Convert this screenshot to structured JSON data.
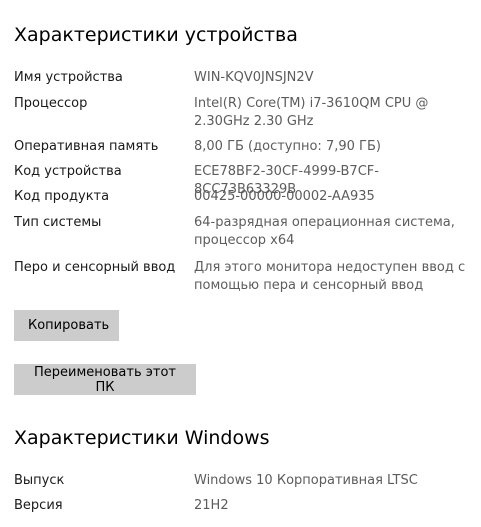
{
  "device_specs": {
    "title": "Характеристики устройства",
    "rows": [
      {
        "label": "Имя устройства",
        "value": "WIN-KQV0JNSJN2V"
      },
      {
        "label": "Процессор",
        "value": "Intel(R) Core(TM) i7-3610QM CPU @\n2.30GHz   2.30 GHz"
      },
      {
        "label": "Оперативная память",
        "value": "8,00 ГБ (доступно: 7,90 ГБ)"
      },
      {
        "label": "Код устройства",
        "value": "ECE78BF2-30CF-4999-B7CF-8CC73B63329B"
      },
      {
        "label": "Код продукта",
        "value": "00425-00000-00002-AA935"
      },
      {
        "label": "Тип системы",
        "value": "64-разрядная операционная система,\nпроцессор x64"
      },
      {
        "label": "Перо и сенсорный ввод",
        "value": "Для этого монитора недоступен ввод с\nпомощью пера и сенсорный ввод"
      }
    ],
    "copy_button": "Копировать",
    "rename_button": "Переименовать этот ПК"
  },
  "windows_specs": {
    "title": "Характеристики Windows",
    "rows": [
      {
        "label": "Выпуск",
        "value": "Windows 10 Корпоративная LTSC"
      },
      {
        "label": "Версия",
        "value": "21H2"
      }
    ]
  },
  "colors": {
    "background": "#ffffff",
    "button_bg": "#cccccc",
    "label_text": "#1a1a1a",
    "value_text": "#5c5c5c"
  }
}
